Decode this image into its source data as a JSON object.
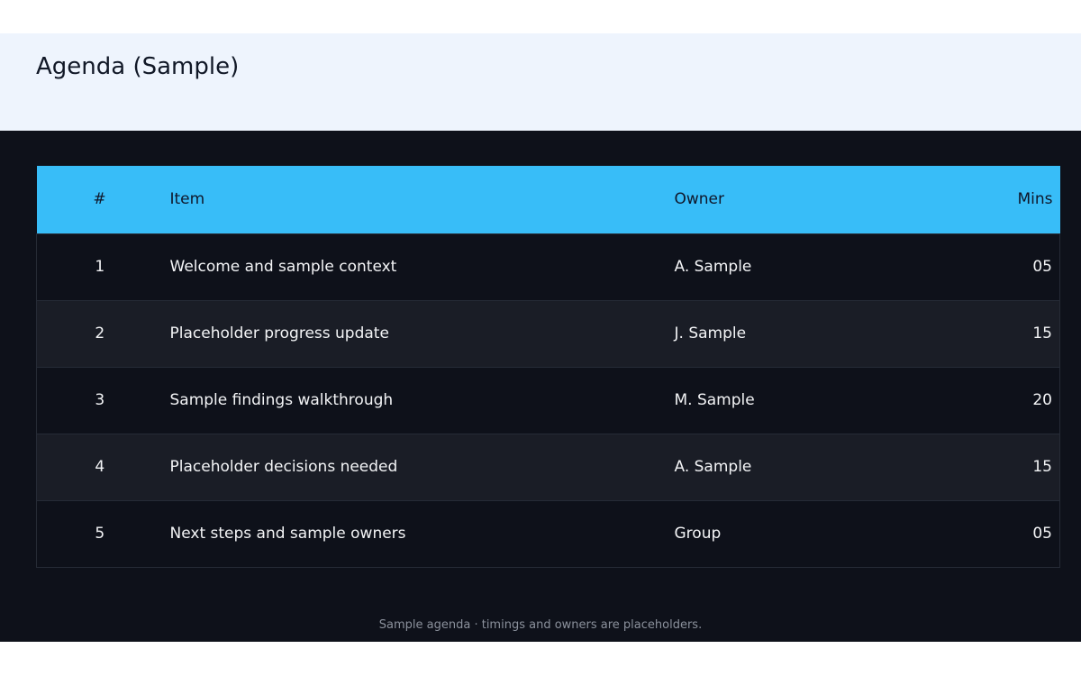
{
  "header": {
    "title": "Agenda (Sample)"
  },
  "table": {
    "columns": {
      "num": "#",
      "item": "Item",
      "owner": "Owner",
      "mins": "Mins"
    },
    "rows": [
      {
        "num": "1",
        "item": "Welcome and sample context",
        "owner": "A. Sample",
        "mins": "05"
      },
      {
        "num": "2",
        "item": "Placeholder progress update",
        "owner": "J. Sample",
        "mins": "15"
      },
      {
        "num": "3",
        "item": "Sample findings walkthrough",
        "owner": "M. Sample",
        "mins": "20"
      },
      {
        "num": "4",
        "item": "Placeholder decisions needed",
        "owner": "A. Sample",
        "mins": "15"
      },
      {
        "num": "5",
        "item": "Next steps and sample owners",
        "owner": "Group",
        "mins": "05"
      }
    ]
  },
  "footer": {
    "note": "Sample agenda  ·  timings and owners are placeholders."
  },
  "colors": {
    "header_bg": "#eef4fd",
    "main_bg": "#0e111a",
    "table_header_bg": "#38bdf8",
    "row_alt_bg": "#1a1d26"
  }
}
